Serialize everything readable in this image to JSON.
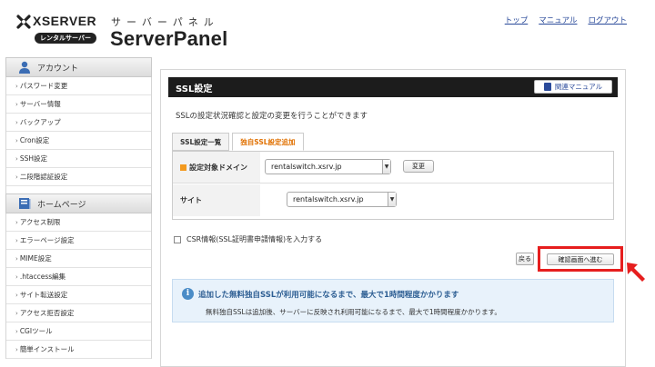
{
  "header": {
    "brand": "XSERVER",
    "badge": "レンタルサーバー",
    "title_kana": "サーバーパネル",
    "title": "ServerPanel",
    "links": [
      "トップ",
      "マニュアル",
      "ログアウト"
    ]
  },
  "sidebar": {
    "account": {
      "heading": "アカウント",
      "items": [
        "パスワード変更",
        "サーバー情報",
        "バックアップ",
        "Cron設定",
        "SSH設定",
        "二段階認証設定"
      ]
    },
    "homepage": {
      "heading": "ホームページ",
      "items": [
        "アクセス制限",
        "エラーページ設定",
        "MIME設定",
        ".htaccess編集",
        "サイト転送設定",
        "アクセス拒否設定",
        "CGIツール",
        "簡単インストール"
      ]
    }
  },
  "main": {
    "title": "SSL設定",
    "manual_button": "関連マニュアル",
    "description": "SSLの設定状況確認と設定の変更を行うことができます",
    "tabs": [
      {
        "label": "SSL設定一覧",
        "active": false
      },
      {
        "label": "独自SSL設定追加",
        "active": true
      }
    ],
    "form": {
      "domain_label": "設定対象ドメイン",
      "domain_value": "rentalswitch.xsrv.jp",
      "change_button": "変更",
      "site_label": "サイト",
      "site_value": "rentalswitch.xsrv.jp"
    },
    "csr_label": "CSR情報(SSL証明書申請情報)を入力する",
    "back_button": "戻る",
    "confirm_button": "確認画面へ進む",
    "notice": {
      "heading": "追加した無料独自SSLが利用可能になるまで、最大で1時間程度かかります",
      "body": "無料独自SSLは追加後、サーバーに反映され利用可能になるまで、最大で1時間程度かかります。"
    }
  },
  "colors": {
    "accent_orange": "#e07000",
    "highlight_red": "#e61e1e",
    "link_blue": "#2a4a9a",
    "notice_bg": "#e8f2fb"
  },
  "icons": [
    "xserver-logo-icon",
    "person-icon",
    "book-icon",
    "manual-icon",
    "info-icon",
    "arrow-pointer-icon"
  ]
}
